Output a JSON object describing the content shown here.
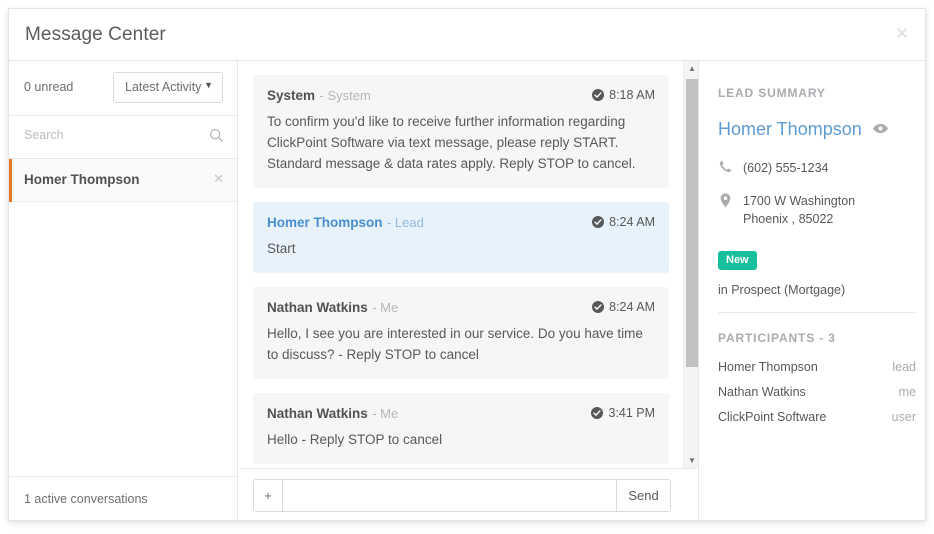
{
  "header": {
    "title": "Message Center",
    "close_icon": "close-icon"
  },
  "sidebar": {
    "unread_label": "0 unread",
    "sort": {
      "selected": "Latest Activity",
      "options": [
        "Latest Activity"
      ],
      "caret_icon": "chevron-down-icon"
    },
    "search": {
      "placeholder": "Search",
      "value": "",
      "icon": "search-icon"
    },
    "conversations": [
      {
        "name": "Homer Thompson",
        "selected": true,
        "accent_color": "#e8762c",
        "close_icon": "close-icon"
      }
    ],
    "footer_label": "1 active conversations"
  },
  "messages": {
    "items": [
      {
        "sender": "System",
        "role": "System",
        "time": "8:18 AM",
        "status_icon": "check-circle-icon",
        "direction": "system",
        "text": "To confirm you'd like to receive further information regarding ClickPoint Software via text message, please reply START. Standard message & data rates apply. Reply STOP to cancel."
      },
      {
        "sender": "Homer Thompson",
        "role": "Lead",
        "time": "8:24 AM",
        "status_icon": "check-circle-icon",
        "direction": "inbound",
        "text": "Start"
      },
      {
        "sender": "Nathan Watkins",
        "role": "Me",
        "time": "8:24 AM",
        "status_icon": "check-circle-icon",
        "direction": "outbound",
        "text": "Hello, I see you are interested in our service. Do you have time to discuss? - Reply STOP to cancel"
      },
      {
        "sender": "Nathan Watkins",
        "role": "Me",
        "time": "3:41 PM",
        "status_icon": "check-circle-icon",
        "direction": "outbound",
        "text": "Hello - Reply STOP to cancel"
      }
    ],
    "scrollbar": {
      "up_icon": "triangle-up-icon",
      "down_icon": "triangle-down-icon"
    }
  },
  "compose": {
    "attach_label": "+",
    "input_value": "",
    "input_placeholder": "",
    "send_label": "Send"
  },
  "lead_summary": {
    "section_label": "LEAD SUMMARY",
    "name": "Homer Thompson",
    "name_color": "#5e9bd4",
    "view_icon": "eye-icon",
    "phone": "(602) 555-1234",
    "phone_icon": "phone-icon",
    "address_line1": "1700 W Washington",
    "address_line2": "Phoenix , 85022",
    "address_icon": "map-pin-icon",
    "status_badge": "New",
    "status_badge_color": "#17bf9c",
    "stage": "in Prospect (Mortgage)",
    "participants_label": "PARTICIPANTS - 3",
    "participants": [
      {
        "name": "Homer Thompson",
        "role": "lead"
      },
      {
        "name": "Nathan Watkins",
        "role": "me"
      },
      {
        "name": "ClickPoint Software",
        "role": "user"
      }
    ]
  }
}
